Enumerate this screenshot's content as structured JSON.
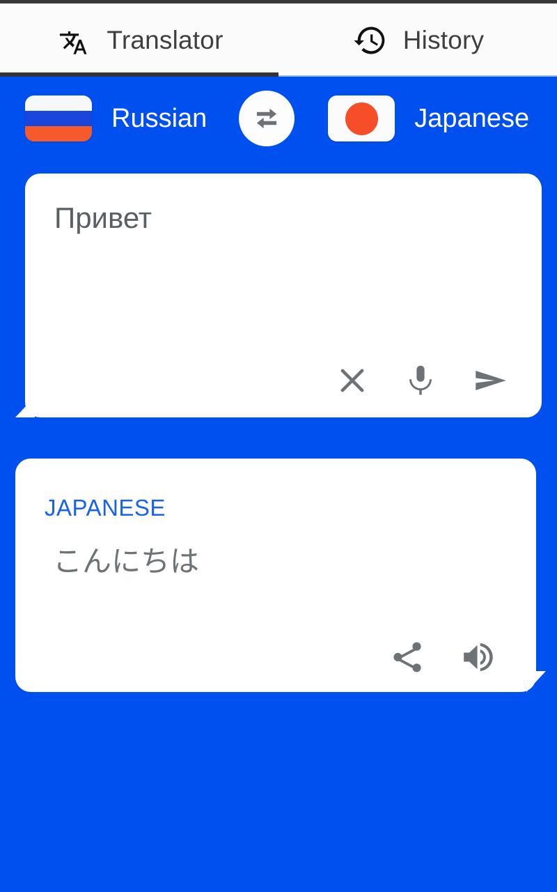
{
  "app": {
    "background_color": "#0050f0",
    "card_color": "#ffffff"
  },
  "tabs": [
    {
      "id": "translator",
      "label": "Translator",
      "icon": "translate-icon",
      "selected": true
    },
    {
      "id": "history",
      "label": "History",
      "icon": "history-clock-icon",
      "selected": false
    }
  ],
  "language_bar": {
    "source": {
      "name": "Russian",
      "flag": "russia-flag-icon"
    },
    "target": {
      "name": "Japanese",
      "flag": "japan-flag-icon"
    },
    "swap_icon": "swap-horizontal-icon"
  },
  "input_card": {
    "text": "Привет",
    "placeholder": "Enter text",
    "actions": [
      {
        "id": "clear",
        "icon": "close-icon"
      },
      {
        "id": "mic",
        "icon": "microphone-icon"
      },
      {
        "id": "send",
        "icon": "send-icon"
      }
    ]
  },
  "output_card": {
    "language_label": "JAPANESE",
    "language_label_color": "#1762f0",
    "text": "こんにちは",
    "actions": [
      {
        "id": "share",
        "icon": "share-icon"
      },
      {
        "id": "speak",
        "icon": "volume-speaker-icon"
      }
    ]
  }
}
